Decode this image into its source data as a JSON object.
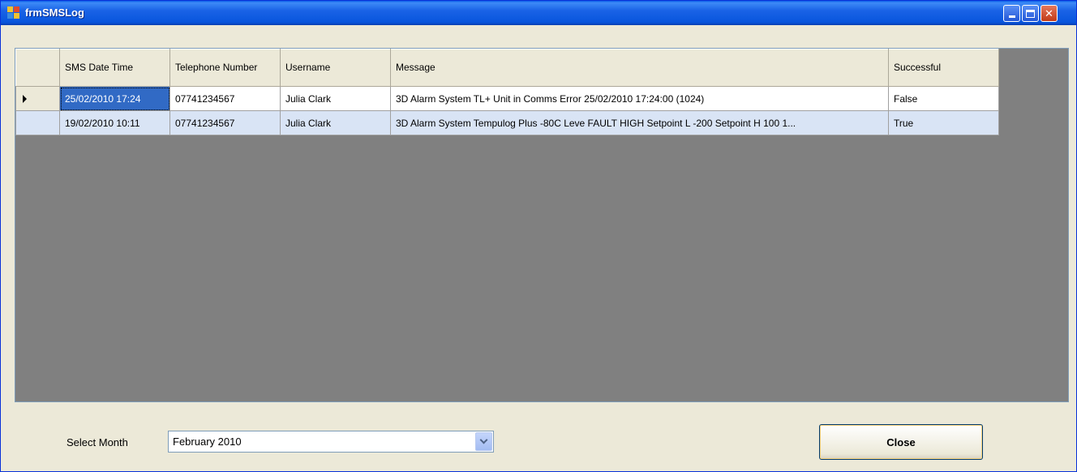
{
  "window": {
    "title": "frmSMSLog"
  },
  "grid": {
    "columns": [
      "SMS Date Time",
      "Telephone Number",
      "Username",
      "Message",
      "Successful"
    ],
    "rows": [
      {
        "date_time": "25/02/2010 17:24",
        "telephone": "07741234567",
        "username": "Julia Clark",
        "message": "3D Alarm System  TL+ Unit in Comms Error 25/02/2010 17:24:00 (1024)",
        "successful": "False"
      },
      {
        "date_time": "19/02/2010 10:11",
        "telephone": "07741234567",
        "username": "Julia Clark",
        "message": "3D Alarm System  Tempulog Plus -80C Leve FAULT HIGH Setpoint L -200 Setpoint H 100 1...",
        "successful": "True"
      }
    ]
  },
  "controls": {
    "month_label": "Select Month",
    "month_value": "February 2010",
    "close_label": "Close"
  },
  "colors": {
    "selection": "#316ac5",
    "alt_row": "#d9e4f5",
    "grid_bg": "#808080"
  }
}
